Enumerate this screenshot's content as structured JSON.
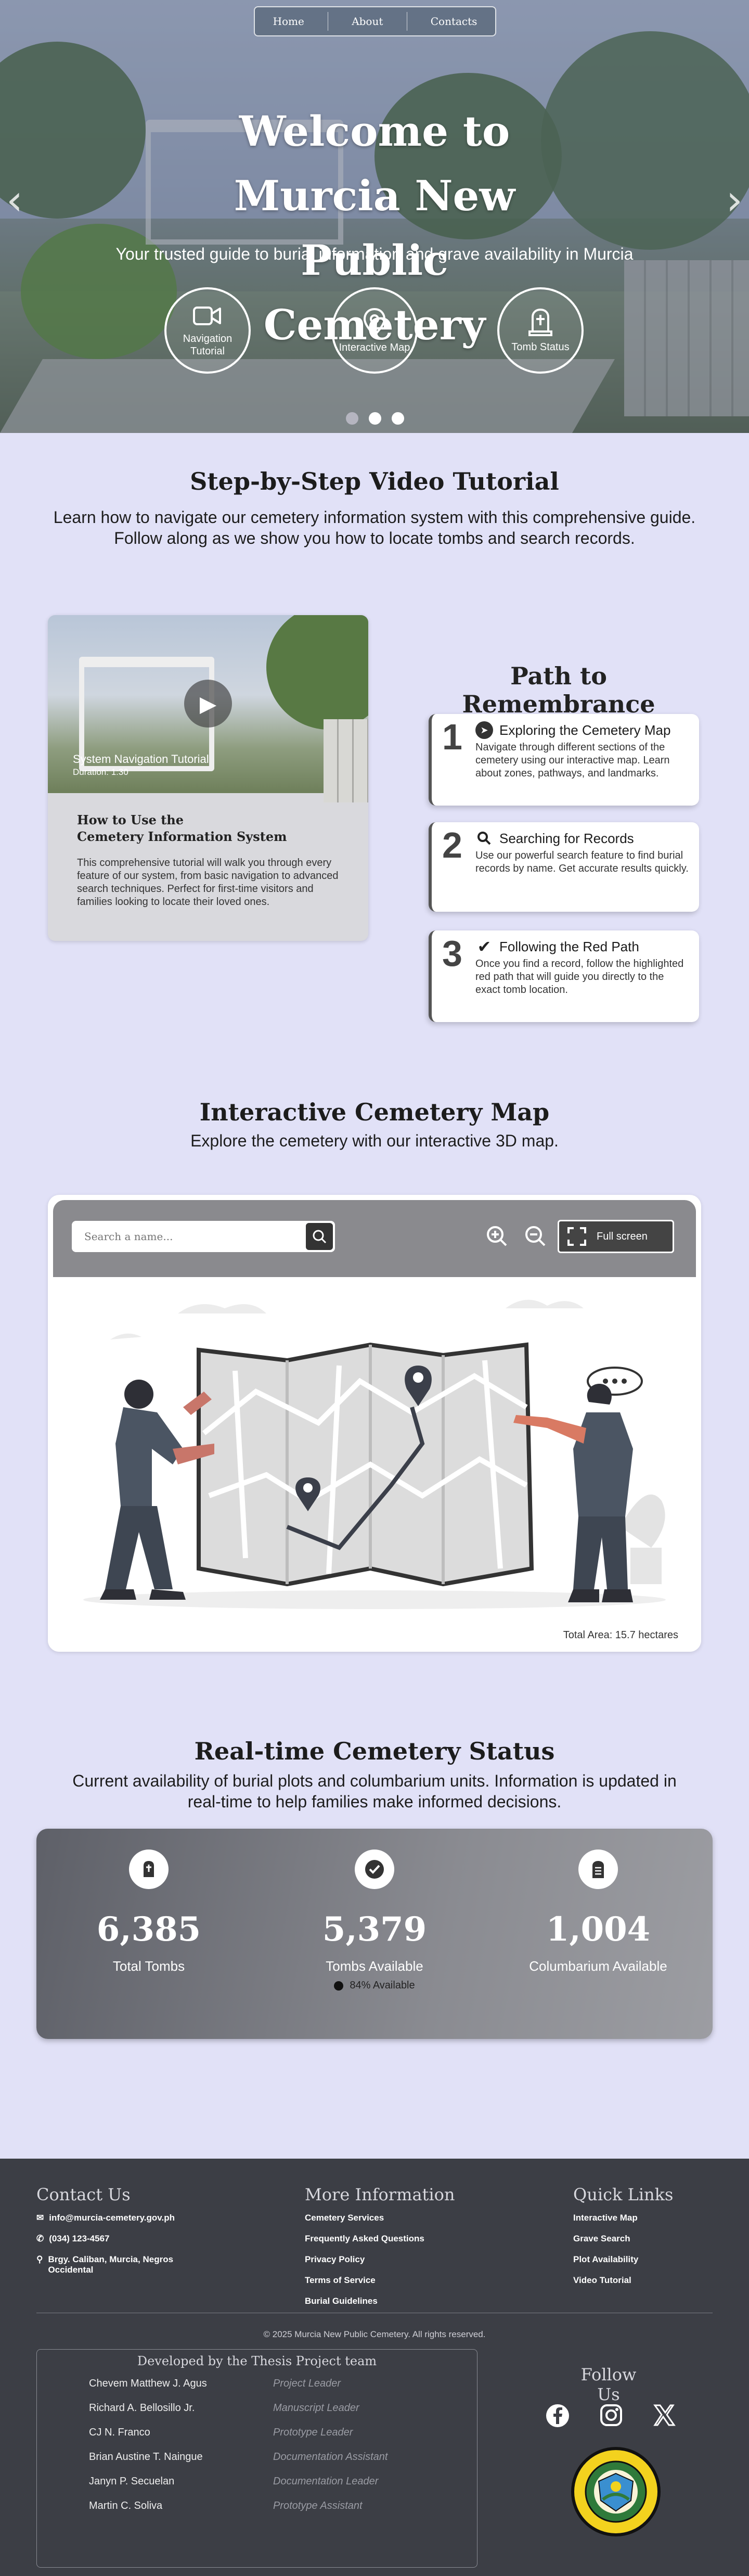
{
  "nav": {
    "home": "Home",
    "about": "About",
    "contacts": "Contacts"
  },
  "hero": {
    "title": "Welcome to Murcia New Public Cemetery",
    "subtitle": "Your trusted guide to burial information and grave availability in Murcia",
    "quick_links": [
      {
        "label": "Navigation Tutorial",
        "icon": "video-camera-icon"
      },
      {
        "label": "Interactive Map",
        "icon": "map-pin-icon"
      },
      {
        "label": "Tomb Status",
        "icon": "tombstone-icon"
      }
    ],
    "active_slide": 2,
    "slide_count": 3
  },
  "tutorial": {
    "title": "Step-by-Step Video Tutorial",
    "description": "Learn how to navigate our cemetery information system with this comprehensive guide. Follow along as we show you how to locate tombs and search records.",
    "video": {
      "title": "System Navigation Tutorial",
      "duration": "Duration: 1:30",
      "heading_line1": "How to Use the",
      "heading_line2": "Cemetery Information System",
      "body": "This comprehensive tutorial will walk you through every feature of our system, from basic navigation to advanced search techniques. Perfect for first-time visitors and families looking to locate their loved ones."
    },
    "path_title": "Path to Remembrance",
    "steps": [
      {
        "num": "1",
        "icon": "compass-icon",
        "title": "Exploring the Cemetery Map",
        "text": "Navigate through different sections of the cemetery using our interactive map. Learn about zones, pathways, and landmarks."
      },
      {
        "num": "2",
        "icon": "search-icon",
        "title": "Searching for Records",
        "text": "Use our powerful search feature to find burial records by name. Get accurate results quickly."
      },
      {
        "num": "3",
        "icon": "check-icon",
        "title": "Following the Red Path",
        "text": "Once you find a record, follow the highlighted red path that will guide you directly to the exact tomb location."
      }
    ]
  },
  "map": {
    "title": "Interactive Cemetery Map",
    "description": "Explore the cemetery with our interactive 3D map.",
    "search_placeholder": "Search a name...",
    "fullscreen_label": "Full screen",
    "total_area": "Total Area:  15.7 hectares"
  },
  "status": {
    "title": "Real-time Cemetery Status",
    "description": "Current availability of burial plots and columbarium units. Information is updated in real-time to help families make informed decisions.",
    "stats": [
      {
        "value": "6,385",
        "label": "Total Tombs",
        "icon": "tomb-icon"
      },
      {
        "value": "5,379",
        "label": "Tombs Available",
        "icon": "check-circle-icon",
        "percent": "84% Available"
      },
      {
        "value": "1,004",
        "label": "Columbarium Available",
        "icon": "columbarium-icon"
      }
    ]
  },
  "footer": {
    "contact_title": "Contact Us",
    "email": "info@murcia-cemetery.gov.ph",
    "phone": "(034) 123-4567",
    "address": "Brgy. Caliban, Murcia, Negros Occidental",
    "more_title": "More Information",
    "more_links": [
      "Cemetery Services",
      "Frequently Asked Questions",
      "Privacy Policy",
      "Terms of Service",
      "Burial Guidelines"
    ],
    "quick_title": "Quick Links",
    "quick_links": [
      "Interactive Map",
      "Grave Search",
      "Plot Availability",
      "Video Tutorial"
    ],
    "copyright": "© 2025 Murcia New Public Cemetery. All rights reserved.",
    "team_title": "Developed by the Thesis Project team",
    "team": [
      {
        "name": "Chevem Matthew J. Agus",
        "role": "Project Leader"
      },
      {
        "name": "Richard A. Bellosillo Jr.",
        "role": "Manuscript Leader"
      },
      {
        "name": "CJ N. Franco",
        "role": "Prototype Leader"
      },
      {
        "name": "Brian Austine T. Naingue",
        "role": "Documentation Assistant"
      },
      {
        "name": "Janyn P. Secuelan",
        "role": "Documentation Leader"
      },
      {
        "name": "Martin C. Soliva",
        "role": "Prototype Assistant"
      }
    ],
    "follow_title": "Follow Us",
    "seal_text": "MUNICIPALITY OF MURCIA · PROVINCE OF NEGROS OCCIDENTAL"
  }
}
